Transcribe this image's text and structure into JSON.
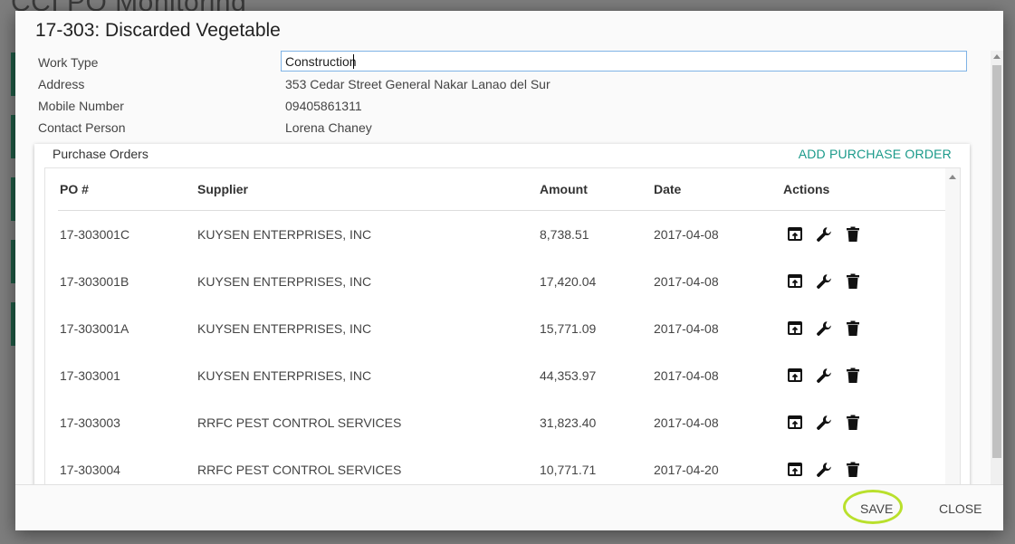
{
  "background": {
    "title": "CCI PO Monitoring"
  },
  "modal": {
    "title": "17-303: Discarded Vegetable",
    "fields": {
      "work_type_label": "Work Type",
      "work_type_value": "Construction",
      "address_label": "Address",
      "address_value": "353 Cedar Street General Nakar Lanao del Sur",
      "mobile_label": "Mobile Number",
      "mobile_value": "09405861311",
      "contact_label": "Contact Person",
      "contact_value": "Lorena Chaney"
    },
    "purchase_orders": {
      "heading": "Purchase Orders",
      "add_label": "ADD PURCHASE ORDER",
      "columns": [
        "PO #",
        "Supplier",
        "Amount",
        "Date",
        "Actions"
      ],
      "rows": [
        {
          "po": "17-303001C",
          "supplier": "KUYSEN ENTERPRISES, INC",
          "amount": "8,738.51",
          "date": "2017-04-08"
        },
        {
          "po": "17-303001B",
          "supplier": "KUYSEN ENTERPRISES, INC",
          "amount": "17,420.04",
          "date": "2017-04-08"
        },
        {
          "po": "17-303001A",
          "supplier": "KUYSEN ENTERPRISES, INC",
          "amount": "15,771.09",
          "date": "2017-04-08"
        },
        {
          "po": "17-303001",
          "supplier": "KUYSEN ENTERPRISES, INC",
          "amount": "44,353.97",
          "date": "2017-04-08"
        },
        {
          "po": "17-303003",
          "supplier": "RRFC PEST CONTROL SERVICES",
          "amount": "31,823.40",
          "date": "2017-04-08"
        },
        {
          "po": "17-303004",
          "supplier": "RRFC PEST CONTROL SERVICES",
          "amount": "10,771.71",
          "date": "2017-04-20"
        }
      ],
      "row_actions": [
        "upload-icon",
        "wrench-icon",
        "trash-icon"
      ]
    },
    "footer": {
      "save_label": "SAVE",
      "close_label": "CLOSE"
    }
  },
  "colors": {
    "accent": "#1a9a8a",
    "highlight": "#b9e02c",
    "input_border": "#7fb3e6"
  }
}
